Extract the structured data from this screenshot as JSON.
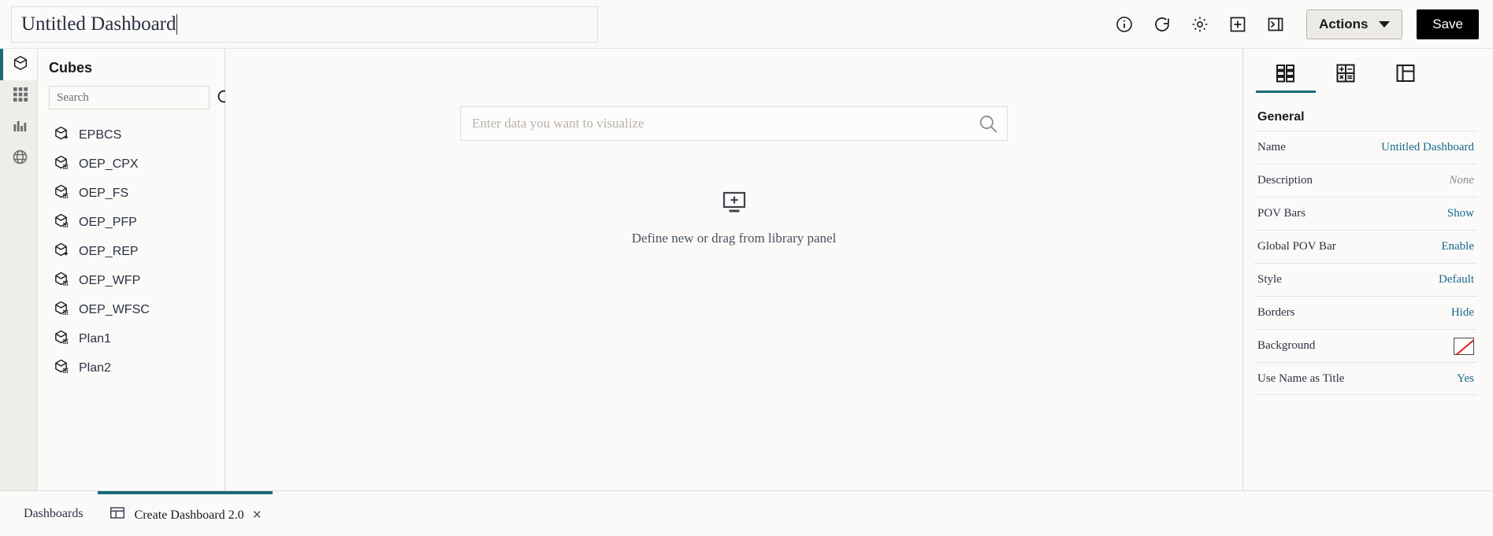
{
  "window": {
    "title_value": "Untitled Dashboard"
  },
  "toolbar": {
    "icons": [
      {
        "name": "info-icon",
        "label": "Info"
      },
      {
        "name": "refresh-icon",
        "label": "Refresh"
      },
      {
        "name": "gear-icon",
        "label": "Settings"
      },
      {
        "name": "add-square-icon",
        "label": "Add"
      },
      {
        "name": "expand-panel-icon",
        "label": "Toggle Panel"
      }
    ],
    "actions_label": "Actions",
    "save_label": "Save"
  },
  "rail": {
    "items": [
      {
        "name": "cubes",
        "icon": "cube-icon",
        "active": true
      },
      {
        "name": "grid",
        "icon": "grid-icon",
        "active": false
      },
      {
        "name": "charts",
        "icon": "bar-chart-icon",
        "active": false
      },
      {
        "name": "global",
        "icon": "globe-icon",
        "active": false
      }
    ]
  },
  "library": {
    "title": "Cubes",
    "search_placeholder": "Search",
    "search_value": "",
    "cubes": [
      {
        "label": "EPBCS",
        "badge": "plus"
      },
      {
        "label": "OEP_CPX",
        "badge": "grid"
      },
      {
        "label": "OEP_FS",
        "badge": "grid"
      },
      {
        "label": "OEP_PFP",
        "badge": "grid"
      },
      {
        "label": "OEP_REP",
        "badge": "plus"
      },
      {
        "label": "OEP_WFP",
        "badge": "grid"
      },
      {
        "label": "OEP_WFSC",
        "badge": "grid"
      },
      {
        "label": "Plan1",
        "badge": "grid"
      },
      {
        "label": "Plan2",
        "badge": "grid"
      }
    ]
  },
  "canvas": {
    "search_placeholder": "Enter data you want to visualize",
    "search_value": "",
    "empty_text": "Define new or drag from library panel"
  },
  "properties": {
    "tabs": [
      {
        "name": "general-tab",
        "icon": "layout-grid-icon",
        "active": true
      },
      {
        "name": "calc-tab",
        "icon": "calculator-icon",
        "active": false
      },
      {
        "name": "layout-tab",
        "icon": "panel-layout-icon",
        "active": false
      }
    ],
    "heading": "General",
    "rows": [
      {
        "key": "Name",
        "value": "Untitled Dashboard",
        "kind": "link"
      },
      {
        "key": "Description",
        "value": "None",
        "kind": "muted"
      },
      {
        "key": "POV Bars",
        "value": "Show",
        "kind": "link"
      },
      {
        "key": "Global POV Bar",
        "value": "Enable",
        "kind": "link"
      },
      {
        "key": "Style",
        "value": "Default",
        "kind": "link"
      },
      {
        "key": "Borders",
        "value": "Hide",
        "kind": "link"
      },
      {
        "key": "Background",
        "value": "",
        "kind": "swatch"
      },
      {
        "key": "Use Name as Title",
        "value": "Yes",
        "kind": "link"
      }
    ]
  },
  "tabbar": {
    "dashboards_label": "Dashboards",
    "active_tab_label": "Create Dashboard 2.0",
    "close_glyph": "×"
  },
  "colors": {
    "accent": "#1a6b7a",
    "link": "#176a8a",
    "bg": "#fbfaf9",
    "save_bg": "#000000"
  }
}
